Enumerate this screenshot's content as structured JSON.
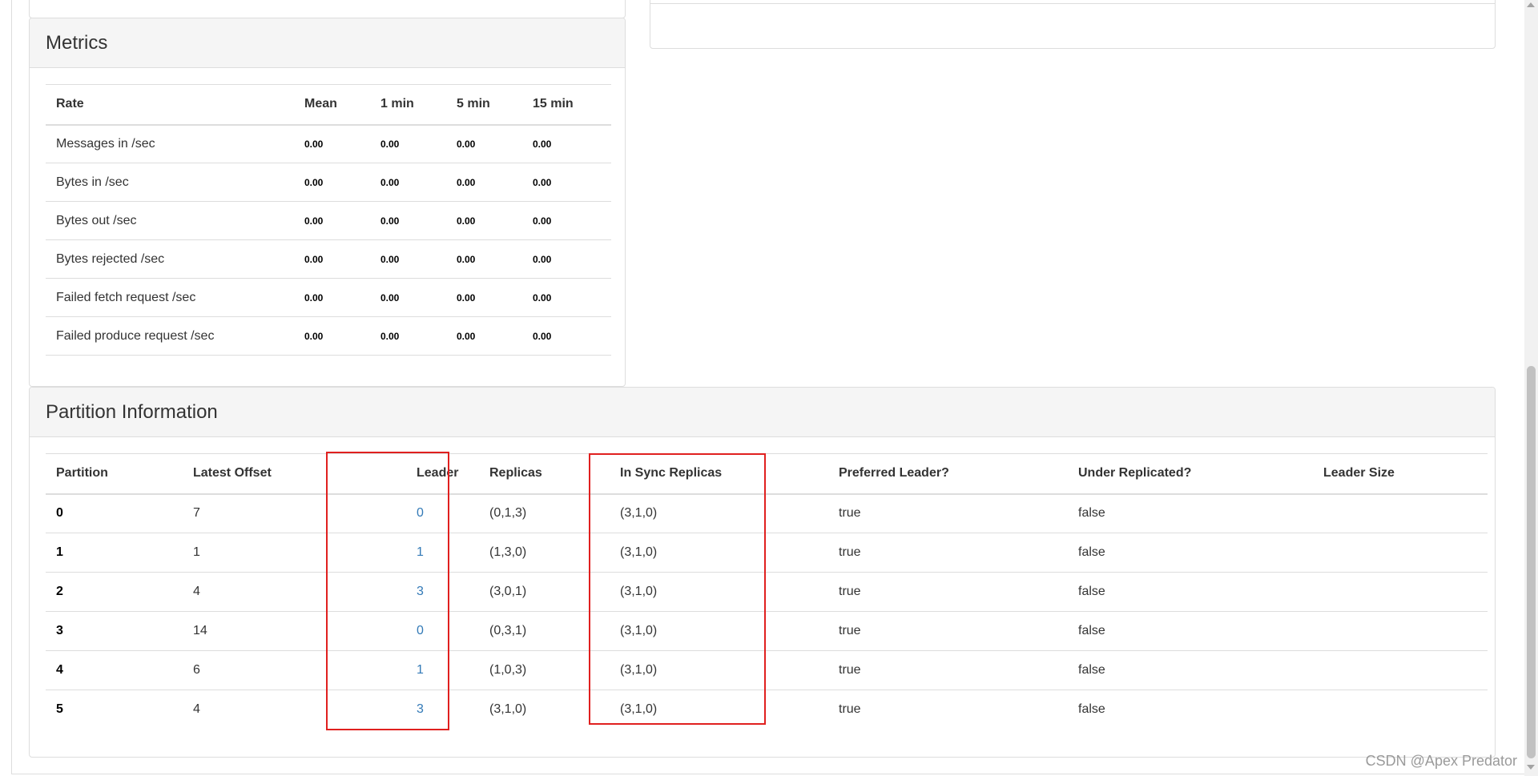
{
  "metrics": {
    "title": "Metrics",
    "columns": [
      "Rate",
      "Mean",
      "1 min",
      "5 min",
      "15 min"
    ],
    "rows": [
      {
        "rate": "Messages in /sec",
        "mean": "0.00",
        "m1": "0.00",
        "m5": "0.00",
        "m15": "0.00"
      },
      {
        "rate": "Bytes in /sec",
        "mean": "0.00",
        "m1": "0.00",
        "m5": "0.00",
        "m15": "0.00"
      },
      {
        "rate": "Bytes out /sec",
        "mean": "0.00",
        "m1": "0.00",
        "m5": "0.00",
        "m15": "0.00"
      },
      {
        "rate": "Bytes rejected /sec",
        "mean": "0.00",
        "m1": "0.00",
        "m5": "0.00",
        "m15": "0.00"
      },
      {
        "rate": "Failed fetch request /sec",
        "mean": "0.00",
        "m1": "0.00",
        "m5": "0.00",
        "m15": "0.00"
      },
      {
        "rate": "Failed produce request /sec",
        "mean": "0.00",
        "m1": "0.00",
        "m5": "0.00",
        "m15": "0.00"
      }
    ]
  },
  "partitions": {
    "title": "Partition Information",
    "columns": [
      "Partition",
      "Latest Offset",
      "Leader",
      "Replicas",
      "In Sync Replicas",
      "Preferred Leader?",
      "Under Replicated?",
      "Leader Size"
    ],
    "rows": [
      {
        "partition": "0",
        "offset": "7",
        "leader": "0",
        "replicas": "(0,1,3)",
        "isr": "(3,1,0)",
        "preferred": "true",
        "under": "false"
      },
      {
        "partition": "1",
        "offset": "1",
        "leader": "1",
        "replicas": "(1,3,0)",
        "isr": "(3,1,0)",
        "preferred": "true",
        "under": "false"
      },
      {
        "partition": "2",
        "offset": "4",
        "leader": "3",
        "replicas": "(3,0,1)",
        "isr": "(3,1,0)",
        "preferred": "true",
        "under": "false"
      },
      {
        "partition": "3",
        "offset": "14",
        "leader": "0",
        "replicas": "(0,3,1)",
        "isr": "(3,1,0)",
        "preferred": "true",
        "under": "false"
      },
      {
        "partition": "4",
        "offset": "6",
        "leader": "1",
        "replicas": "(1,0,3)",
        "isr": "(3,1,0)",
        "preferred": "true",
        "under": "false"
      },
      {
        "partition": "5",
        "offset": "4",
        "leader": "3",
        "replicas": "(3,1,0)",
        "isr": "(3,1,0)",
        "preferred": "true",
        "under": "false"
      }
    ]
  },
  "watermark": "CSDN @Apex  Predator",
  "colors": {
    "link": "#337ab7",
    "highlight": "#e0201f",
    "panel_heading": "#f5f5f5"
  }
}
